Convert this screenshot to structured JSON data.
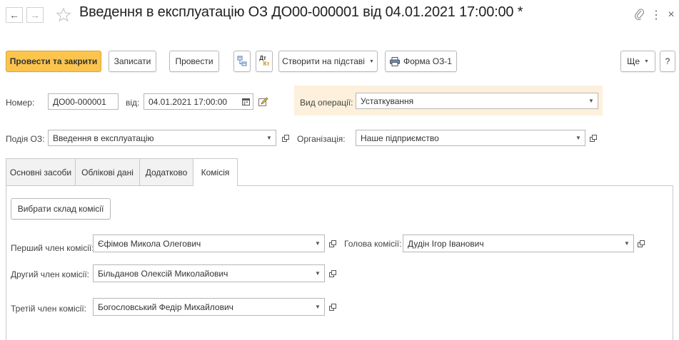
{
  "window": {
    "title": "Введення в експлуатацію ОЗ ДО00-000001 від 04.01.2021 17:00:00 *",
    "back_glyph": "←",
    "forward_glyph": "→",
    "more_glyph": "⋮",
    "close_glyph": "×"
  },
  "toolbar": {
    "post_and_close": "Провести та закрити",
    "save": "Записати",
    "post": "Провести",
    "dt_kt_top": "Дт",
    "dt_kt_bottom": "Кт",
    "create_based": "Створити на підставі",
    "print_form": "Форма ОЗ-1",
    "more": "Ще",
    "help": "?"
  },
  "form": {
    "number_label": "Номер:",
    "number_value": "ДО00-000001",
    "date_label": "від:",
    "date_value": "04.01.2021 17:00:00",
    "operation_label": "Вид операції:",
    "operation_value": "Устаткування",
    "event_label": "Подія ОЗ:",
    "event_value": "Введення в експлуатацію",
    "org_label": "Організація:",
    "org_value": "Наше підприємство"
  },
  "tabs": [
    {
      "label": "Основні засоби",
      "active": false
    },
    {
      "label": "Облікові дані",
      "active": false
    },
    {
      "label": "Додатково",
      "active": false
    },
    {
      "label": "Комісія",
      "active": true
    }
  ],
  "commission": {
    "choose_button": "Вибрати склад комісії",
    "first_label": "Перший член комісії:",
    "first_value": "Єфімов Микола Олегович",
    "head_label": "Голова комісії:",
    "head_value": "Дудін Ігор Іванович",
    "second_label": "Другий член комісії:",
    "second_value": "Більданов Олексій Миколайович",
    "third_label": "Третій член комісії:",
    "third_value": "Богословський Федір Михайлович"
  },
  "colors": {
    "primary_button": "#fbc54d",
    "operation_highlight": "#fdf0dc",
    "star": "#c8c8c8"
  },
  "icons": {
    "favorite": "star-icon",
    "link": "link-icon",
    "calendar": "calendar-icon",
    "printer": "printer-icon"
  }
}
